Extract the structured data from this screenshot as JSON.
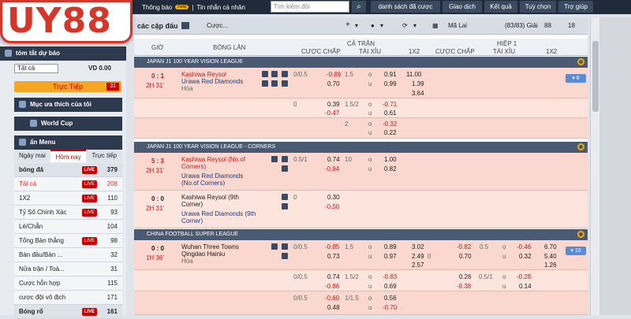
{
  "brand": {
    "logo": "UY88"
  },
  "topbar": {
    "notifications": "Thông báo",
    "notif_badge": "new",
    "messages": "Tin nhắn cá nhân",
    "search_placeholder": "Tìm kiếm đội",
    "buttons": [
      "danh sách đã cược",
      "Giao dịch",
      "Kết quả",
      "Tuỳ chọn",
      "Trợ giúp"
    ]
  },
  "sidebar": {
    "summary": "tóm tắt dự báo",
    "select": "Tất cả",
    "balance": "VD 0.00",
    "live": "Trực Tiếp",
    "live_count": "31",
    "fav": "Mục ưa thích của tôi",
    "worldcup": "World Cup",
    "menu": "ẩn Menu",
    "tabs": [
      "Ngày mai",
      "Hôm nay",
      "Trực tiếp"
    ],
    "sports": [
      {
        "name": "bóng đá",
        "live": "LIVE",
        "n": "379",
        "main": true
      },
      {
        "name": "Tất cả",
        "live": "LIVE",
        "n": "208",
        "red": true
      },
      {
        "name": "1X2",
        "live": "LIVE",
        "n": "110"
      },
      {
        "name": "Tỷ Số Chính Xác",
        "live": "LIVE",
        "n": "93"
      },
      {
        "name": "Lẻ/Chẵn",
        "live": "",
        "n": "104"
      },
      {
        "name": "Tổng Bàn thắng",
        "live": "LIVE",
        "n": "98"
      },
      {
        "name": "Bàn đầu/Bàn ...",
        "live": "",
        "n": "32"
      },
      {
        "name": "Nửa trận / Toà...",
        "live": "",
        "n": "31"
      },
      {
        "name": "Cược hỗn hợp",
        "live": "",
        "n": "115"
      },
      {
        "name": "cược đội vô địch",
        "live": "",
        "n": "171"
      },
      {
        "name": "Bóng rổ",
        "live": "LIVE",
        "n": "161",
        "main": true
      }
    ]
  },
  "subbar": {
    "title": "các cặp đấu",
    "sort": "Cược...",
    "league_filter": "Mã Lai",
    "count": "(83/83) Giải",
    "c1": "88",
    "c2": "18"
  },
  "columns": {
    "time": "GIỜ",
    "match": "BÓNG LĂN",
    "fulltime": "CẢ TRẬN",
    "half": "HIỆP 1",
    "handicap": "CƯỢC CHẤP",
    "ou": "TÀI XỈU",
    "x12": "1X2"
  },
  "leagues": [
    {
      "name": "JAPAN J1 100 YEAR VISION LEAGUE"
    },
    {
      "name": "JAPAN J1 100 YEAR VISION LEAGUE - CORNERS"
    },
    {
      "name": "CHINA FOOTBALL SUPER LEAGUE"
    }
  ],
  "rows": {
    "r1": {
      "score": "0 : 1",
      "time": "2H 31'",
      "home": "Kashiwa Reysol",
      "away": "Urawa Red Diamonds",
      "draw": "Hòa",
      "hc": "0/0.5",
      "hc_h": "-0.89",
      "hc_a": "0.70",
      "ou": "1.5",
      "ou_h": "0.91",
      "ou_a": "0.99",
      "x_h": "11.00",
      "x_a": "1.39",
      "x_d": "3.64",
      "more": "8"
    },
    "r2": {
      "hc": "0",
      "hc_h": "0.39",
      "hc_a": "-0.47",
      "ou": "1.5/2",
      "ou_h": "-0.71",
      "ou_a": "0.61"
    },
    "r3": {
      "ou": "2",
      "ou_h": "-0.32",
      "ou_a": "0.22"
    },
    "r4": {
      "score": "5 : 3",
      "time": "2H 31'",
      "home": "Kashiwa Reysol (No.of Corners)",
      "away": "Urawa Red Diamonds (No.of Corners)",
      "hc": "0.5/1",
      "hc_h": "0.74",
      "hc_a": "-0.94",
      "ou": "10",
      "ou_h": "1.00",
      "ou_a": "0.82"
    },
    "r5": {
      "score": "0 : 0",
      "time": "2H 31'",
      "home": "Kashiwa Reysol (9th Corner)",
      "away": "Urawa Red Diamonds (9th Corner)",
      "hc": "0",
      "hc_h": "0.30",
      "hc_a": "-0.50"
    },
    "r6": {
      "score": "0 : 0",
      "time": "1H 36'",
      "home": "Wuhan Three Towns",
      "away": "Qingdao Hainiu",
      "draw": "Hòa",
      "hc": "0/0.5",
      "hc_h": "-0.85",
      "hc_a": "0.73",
      "ou": "1.5",
      "ou_h": "0.89",
      "ou_a": "0.97",
      "x_h": "3.02",
      "x_a": "2.49",
      "x_d": "2.57",
      "h_hc": "0",
      "h_hc_h": "-0.82",
      "h_hc_a": "0.70",
      "h_ou": "0.5",
      "h_ou_h": "-0.46",
      "h_ou_a": "0.32",
      "h_x_h": "6.70",
      "h_x_a": "5.40",
      "h_x_d": "1.26",
      "more": "10"
    },
    "r7": {
      "hc": "0/0.5",
      "hc_h": "0.74",
      "hc_a": "-0.86",
      "ou": "1.5/2",
      "ou_h": "-0.83",
      "ou_a": "0.69",
      "h_hc_h": "0.26",
      "h_hc_a": "-0.38",
      "h_ou": "0.5/1",
      "h_ou_h": "-0.28",
      "h_ou_a": "0.14"
    },
    "r8": {
      "hc": "0/0.5",
      "hc_h": "-0.60",
      "hc_a": "0.48",
      "ou": "1/1.5",
      "ou_h": "0.56",
      "ou_a": "-0.70"
    }
  }
}
